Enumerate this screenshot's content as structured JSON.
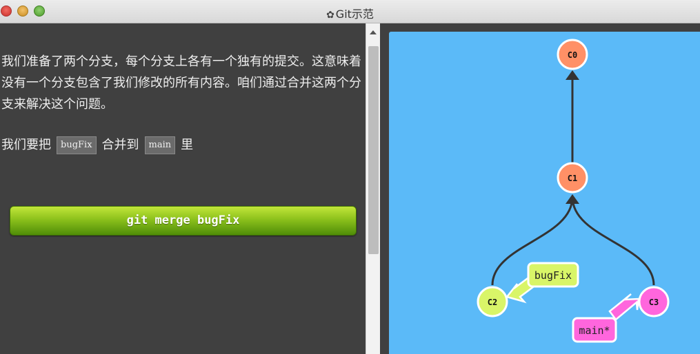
{
  "window": {
    "title": "Git示范",
    "title_icon": "gear-icon"
  },
  "lesson": {
    "paragraph1": "我们准备了两个分支，每个分支上各有一个独有的提交。这意味着没有一个分支包含了我们修改的所有内容。咱们通过合并这两个分支来解决这个问题。",
    "p2_prefix": "我们要把",
    "p2_branch_from": "bugFix",
    "p2_middle": "合并到",
    "p2_branch_to": "main",
    "p2_suffix": "里",
    "command_button": "git merge bugFix"
  },
  "graph": {
    "commits": [
      {
        "id": "C0",
        "color": "#ff9066"
      },
      {
        "id": "C1",
        "color": "#ff9066"
      },
      {
        "id": "C2",
        "color": "#d9f568"
      },
      {
        "id": "C3",
        "color": "#ff66dd"
      }
    ],
    "branches": [
      {
        "name": "bugFix",
        "color": "#d9f568",
        "target": "C2"
      },
      {
        "name": "main*",
        "color": "#ff66dd",
        "target": "C3"
      }
    ],
    "colors": {
      "canvas_bg": "#5bbaf8",
      "edge": "#333333",
      "button_green": "#7cb518"
    }
  }
}
